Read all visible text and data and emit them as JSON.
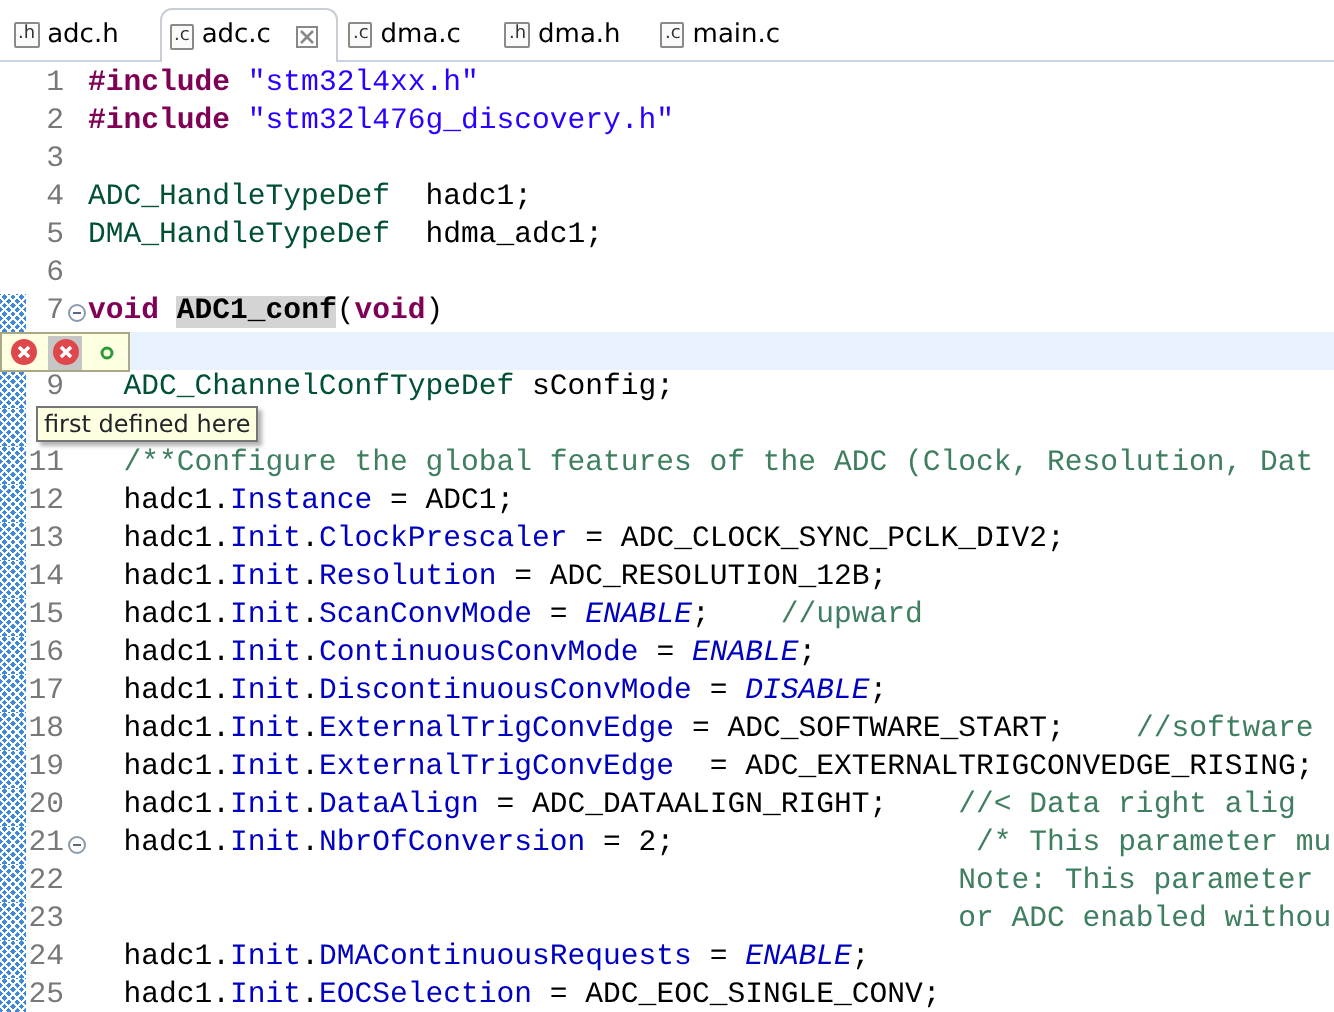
{
  "tabs": [
    {
      "label": "adc.h",
      "icon_text": ".h",
      "selected": false
    },
    {
      "label": "adc.c",
      "icon_text": ".c",
      "selected": true
    },
    {
      "label": "dma.c",
      "icon_text": ".c",
      "selected": false
    },
    {
      "label": "dma.h",
      "icon_text": ".h",
      "selected": false
    },
    {
      "label": "main.c",
      "icon_text": ".c",
      "selected": false
    }
  ],
  "lines": [
    {
      "number": "1",
      "changed": false,
      "current": false,
      "fold": false,
      "tokens": [
        {
          "kind": "keyword",
          "text": "#include "
        },
        {
          "kind": "string",
          "text": "\"stm32l4xx.h\""
        }
      ]
    },
    {
      "number": "2",
      "changed": false,
      "current": false,
      "fold": false,
      "tokens": [
        {
          "kind": "keyword",
          "text": "#include "
        },
        {
          "kind": "string",
          "text": "\"stm32l476g_discovery.h\""
        }
      ]
    },
    {
      "number": "3",
      "changed": false,
      "current": false,
      "fold": false
    },
    {
      "number": "4",
      "changed": false,
      "current": false,
      "fold": false,
      "tokens": [
        {
          "kind": "type",
          "text": "ADC_HandleTypeDef"
        },
        {
          "kind": "plain",
          "text": "  hadc1;"
        }
      ]
    },
    {
      "number": "5",
      "changed": false,
      "current": false,
      "fold": false,
      "tokens": [
        {
          "kind": "type",
          "text": "DMA_HandleTypeDef"
        },
        {
          "kind": "plain",
          "text": "  hdma_adc1;"
        }
      ]
    },
    {
      "number": "6",
      "changed": false,
      "current": false,
      "fold": false
    },
    {
      "number": "7",
      "changed": true,
      "current": false,
      "fold": true,
      "tokens": [
        {
          "kind": "keyword",
          "text": "void "
        },
        {
          "kind": "occurrence",
          "text": "ADC1_conf"
        },
        {
          "kind": "plain",
          "text": "("
        },
        {
          "kind": "keyword",
          "text": "void"
        },
        {
          "kind": "plain",
          "text": ")"
        }
      ]
    },
    {
      "current": true,
      "fold": false
    },
    {
      "number": "9",
      "changed": true,
      "current": false,
      "fold": false,
      "tokens": [
        {
          "kind": "type",
          "text": "  ADC_ChannelConfTypeDef"
        },
        {
          "kind": "plain",
          "text": " sConfig;"
        }
      ]
    },
    {
      "changed": true,
      "current": false,
      "fold": false
    },
    {
      "number": "11",
      "changed": true,
      "current": false,
      "fold": false,
      "tokens": [
        {
          "kind": "comment",
          "text": "  /**Configure the global features of the ADC (Clock, Resolution, Dat"
        }
      ]
    },
    {
      "number": "12",
      "changed": true,
      "current": false,
      "fold": false,
      "tokens": [
        {
          "kind": "plain",
          "text": "  hadc1."
        },
        {
          "kind": "field",
          "text": "Instance"
        },
        {
          "kind": "plain",
          "text": " = ADC1;"
        }
      ]
    },
    {
      "number": "13",
      "changed": true,
      "current": false,
      "fold": false,
      "tokens": [
        {
          "kind": "plain",
          "text": "  hadc1."
        },
        {
          "kind": "field",
          "text": "Init"
        },
        {
          "kind": "plain",
          "text": "."
        },
        {
          "kind": "field",
          "text": "ClockPrescaler"
        },
        {
          "kind": "plain",
          "text": " = ADC_CLOCK_SYNC_PCLK_DIV2;"
        }
      ]
    },
    {
      "number": "14",
      "changed": true,
      "current": false,
      "fold": false,
      "tokens": [
        {
          "kind": "plain",
          "text": "  hadc1."
        },
        {
          "kind": "field",
          "text": "Init"
        },
        {
          "kind": "plain",
          "text": "."
        },
        {
          "kind": "field",
          "text": "Resolution"
        },
        {
          "kind": "plain",
          "text": " = ADC_RESOLUTION_12B;"
        }
      ]
    },
    {
      "number": "15",
      "changed": true,
      "current": false,
      "fold": false,
      "tokens": [
        {
          "kind": "plain",
          "text": "  hadc1."
        },
        {
          "kind": "field",
          "text": "Init"
        },
        {
          "kind": "plain",
          "text": "."
        },
        {
          "kind": "field",
          "text": "ScanConvMode"
        },
        {
          "kind": "plain",
          "text": " = "
        },
        {
          "kind": "constant",
          "text": "ENABLE"
        },
        {
          "kind": "plain",
          "text": ";    "
        },
        {
          "kind": "comment",
          "text": "//upward"
        }
      ]
    },
    {
      "number": "16",
      "changed": true,
      "current": false,
      "fold": false,
      "tokens": [
        {
          "kind": "plain",
          "text": "  hadc1."
        },
        {
          "kind": "field",
          "text": "Init"
        },
        {
          "kind": "plain",
          "text": "."
        },
        {
          "kind": "field",
          "text": "ContinuousConvMode"
        },
        {
          "kind": "plain",
          "text": " = "
        },
        {
          "kind": "constant",
          "text": "ENABLE"
        },
        {
          "kind": "plain",
          "text": ";"
        }
      ]
    },
    {
      "number": "17",
      "changed": true,
      "current": false,
      "fold": false,
      "tokens": [
        {
          "kind": "plain",
          "text": "  hadc1."
        },
        {
          "kind": "field",
          "text": "Init"
        },
        {
          "kind": "plain",
          "text": "."
        },
        {
          "kind": "field",
          "text": "DiscontinuousConvMode"
        },
        {
          "kind": "plain",
          "text": " = "
        },
        {
          "kind": "constant",
          "text": "DISABLE"
        },
        {
          "kind": "plain",
          "text": ";"
        }
      ]
    },
    {
      "number": "18",
      "changed": true,
      "current": false,
      "fold": false,
      "tokens": [
        {
          "kind": "plain",
          "text": "  hadc1."
        },
        {
          "kind": "field",
          "text": "Init"
        },
        {
          "kind": "plain",
          "text": "."
        },
        {
          "kind": "field",
          "text": "ExternalTrigConvEdge"
        },
        {
          "kind": "plain",
          "text": " = ADC_SOFTWARE_START;    "
        },
        {
          "kind": "comment",
          "text": "//software"
        }
      ]
    },
    {
      "number": "19",
      "changed": true,
      "current": false,
      "fold": false,
      "tokens": [
        {
          "kind": "plain",
          "text": "  hadc1."
        },
        {
          "kind": "field",
          "text": "Init"
        },
        {
          "kind": "plain",
          "text": "."
        },
        {
          "kind": "field",
          "text": "ExternalTrigConvEdge"
        },
        {
          "kind": "plain",
          "text": "  = ADC_EXTERNALTRIGCONVEDGE_RISING;"
        }
      ]
    },
    {
      "number": "20",
      "changed": true,
      "current": false,
      "fold": false,
      "tokens": [
        {
          "kind": "plain",
          "text": "  hadc1."
        },
        {
          "kind": "field",
          "text": "Init"
        },
        {
          "kind": "plain",
          "text": "."
        },
        {
          "kind": "field",
          "text": "DataAlign"
        },
        {
          "kind": "plain",
          "text": " = ADC_DATAALIGN_RIGHT;    "
        },
        {
          "kind": "comment",
          "text": "//< Data right alig"
        }
      ]
    },
    {
      "number": "21",
      "changed": true,
      "current": false,
      "fold": true,
      "tokens": [
        {
          "kind": "plain",
          "text": "  hadc1."
        },
        {
          "kind": "field",
          "text": "Init"
        },
        {
          "kind": "plain",
          "text": "."
        },
        {
          "kind": "field",
          "text": "NbrOfConversion"
        },
        {
          "kind": "plain",
          "text": " = 2;                 "
        },
        {
          "kind": "comment",
          "text": "/* This parameter mu"
        }
      ]
    },
    {
      "number": "22",
      "changed": true,
      "current": false,
      "fold": false,
      "tokens": [
        {
          "kind": "comment",
          "text": "                                                 Note: This parameter"
        }
      ]
    },
    {
      "number": "23",
      "changed": true,
      "current": false,
      "fold": false,
      "tokens": [
        {
          "kind": "comment",
          "text": "                                                 or ADC enabled withou"
        }
      ]
    },
    {
      "number": "24",
      "changed": true,
      "current": false,
      "fold": false,
      "tokens": [
        {
          "kind": "plain",
          "text": "  hadc1."
        },
        {
          "kind": "field",
          "text": "Init"
        },
        {
          "kind": "plain",
          "text": "."
        },
        {
          "kind": "field",
          "text": "DMAContinuousRequests"
        },
        {
          "kind": "plain",
          "text": " = "
        },
        {
          "kind": "constant",
          "text": "ENABLE"
        },
        {
          "kind": "plain",
          "text": ";"
        }
      ]
    },
    {
      "number": "25",
      "changed": true,
      "current": false,
      "fold": false,
      "tokens": [
        {
          "kind": "plain",
          "text": "  hadc1."
        },
        {
          "kind": "field",
          "text": "Init"
        },
        {
          "kind": "plain",
          "text": "."
        },
        {
          "kind": "field",
          "text": "EOCSelection"
        },
        {
          "kind": "plain",
          "text": " = ADC_EOC_SINGLE_CONV;"
        }
      ]
    }
  ],
  "annotation_bar": {
    "markers": [
      {
        "kind": "error",
        "selected": false
      },
      {
        "kind": "error",
        "selected": true
      },
      {
        "kind": "info",
        "selected": false
      }
    ]
  },
  "tooltip": {
    "text": "first defined here"
  }
}
